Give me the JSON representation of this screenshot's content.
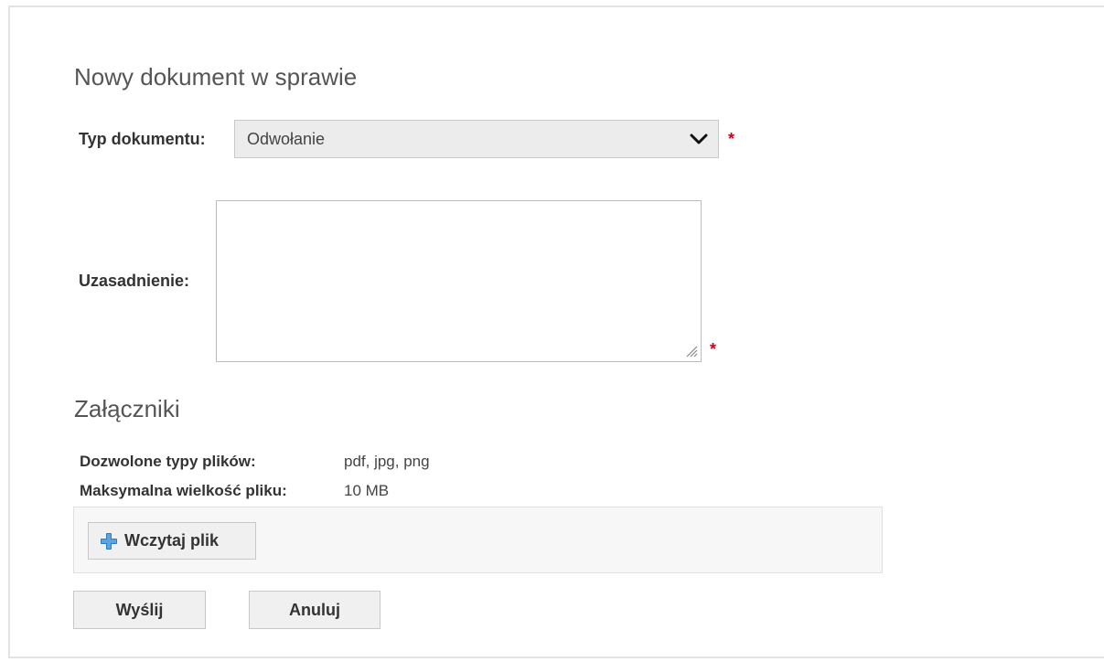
{
  "form": {
    "title": "Nowy dokument w sprawie",
    "document_type": {
      "label": "Typ dokumentu:",
      "selected": "Odwołanie",
      "required_mark": "*"
    },
    "justification": {
      "label": "Uzasadnienie:",
      "value": "",
      "required_mark": "*"
    }
  },
  "attachments": {
    "title": "Załączniki",
    "allowed_types_label": "Dozwolone typy plików:",
    "allowed_types_value": "pdf, jpg, png",
    "max_size_label": "Maksymalna wielkość pliku:",
    "max_size_value": "10 MB",
    "upload_button": {
      "label": "Wczytaj plik",
      "icon": "plus-icon"
    }
  },
  "actions": {
    "send_label": "Wyślij",
    "cancel_label": "Anuluj"
  },
  "colors": {
    "required": "#d0021b",
    "plus_icon": "#2e7bc4"
  }
}
